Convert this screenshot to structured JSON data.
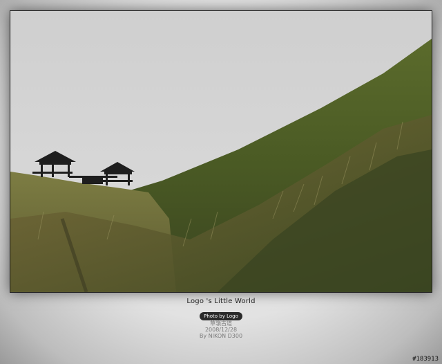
{
  "caption": {
    "title": "Logo 's  Little World",
    "credit": "Photo by Logo",
    "location": "草嶺古道",
    "date": "2008/12/28",
    "camera": "By NIKON D300"
  },
  "watermark": {
    "id": "#183913"
  },
  "colors": {
    "sky": "#d5d5d5",
    "grass_dark": "#3c4a1f",
    "grass_light": "#8a8a4a",
    "pavilion": "#1e1e1e"
  }
}
